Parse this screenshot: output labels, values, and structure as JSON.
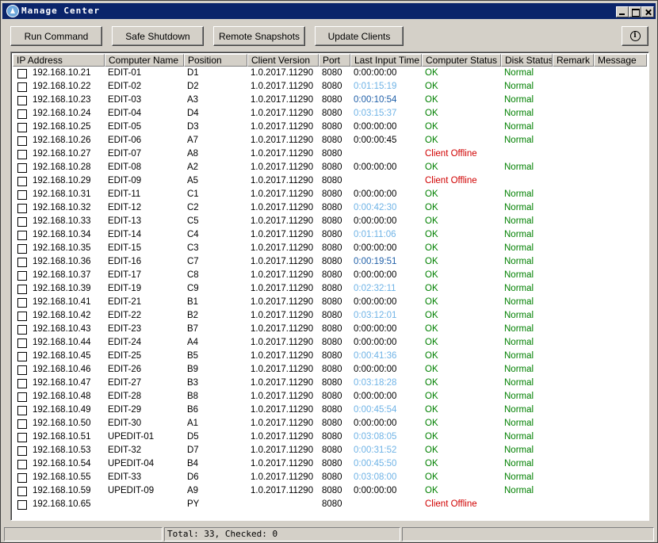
{
  "window": {
    "title": "Manage Center"
  },
  "toolbar": {
    "run_command": "Run Command",
    "safe_shutdown": "Safe Shutdown",
    "remote_snapshots": "Remote Snapshots",
    "update_clients": "Update Clients",
    "info_glyph": "i"
  },
  "table": {
    "columns": [
      "IP Address",
      "Computer Name",
      "Position",
      "Client Version",
      "Port",
      "Last Input Time",
      "Computer Status",
      "Disk Status",
      "Remark",
      "Message"
    ],
    "rows": [
      {
        "ip": "192.168.10.21",
        "name": "EDIT-01",
        "pos": "D1",
        "ver": "1.0.2017.11290",
        "port": "8080",
        "last": "0:00:00:00",
        "last_style": "black",
        "status": "OK",
        "disk": "Normal"
      },
      {
        "ip": "192.168.10.22",
        "name": "EDIT-02",
        "pos": "D2",
        "ver": "1.0.2017.11290",
        "port": "8080",
        "last": "0:01:15:19",
        "last_style": "light",
        "status": "OK",
        "disk": "Normal"
      },
      {
        "ip": "192.168.10.23",
        "name": "EDIT-03",
        "pos": "A3",
        "ver": "1.0.2017.11290",
        "port": "8080",
        "last": "0:00:10:54",
        "last_style": "blue",
        "status": "OK",
        "disk": "Normal"
      },
      {
        "ip": "192.168.10.24",
        "name": "EDIT-04",
        "pos": "D4",
        "ver": "1.0.2017.11290",
        "port": "8080",
        "last": "0:03:15:37",
        "last_style": "light",
        "status": "OK",
        "disk": "Normal"
      },
      {
        "ip": "192.168.10.25",
        "name": "EDIT-05",
        "pos": "D3",
        "ver": "1.0.2017.11290",
        "port": "8080",
        "last": "0:00:00:00",
        "last_style": "black",
        "status": "OK",
        "disk": "Normal"
      },
      {
        "ip": "192.168.10.26",
        "name": "EDIT-06",
        "pos": "A7",
        "ver": "1.0.2017.11290",
        "port": "8080",
        "last": "0:00:00:45",
        "last_style": "black",
        "status": "OK",
        "disk": "Normal"
      },
      {
        "ip": "192.168.10.27",
        "name": "EDIT-07",
        "pos": "A8",
        "ver": "1.0.2017.11290",
        "port": "8080",
        "last": "",
        "last_style": "black",
        "status": "Client Offline",
        "disk": ""
      },
      {
        "ip": "192.168.10.28",
        "name": "EDIT-08",
        "pos": "A2",
        "ver": "1.0.2017.11290",
        "port": "8080",
        "last": "0:00:00:00",
        "last_style": "black",
        "status": "OK",
        "disk": "Normal"
      },
      {
        "ip": "192.168.10.29",
        "name": "EDIT-09",
        "pos": "A5",
        "ver": "1.0.2017.11290",
        "port": "8080",
        "last": "",
        "last_style": "black",
        "status": "Client Offline",
        "disk": ""
      },
      {
        "ip": "192.168.10.31",
        "name": "EDIT-11",
        "pos": "C1",
        "ver": "1.0.2017.11290",
        "port": "8080",
        "last": "0:00:00:00",
        "last_style": "black",
        "status": "OK",
        "disk": "Normal"
      },
      {
        "ip": "192.168.10.32",
        "name": "EDIT-12",
        "pos": "C2",
        "ver": "1.0.2017.11290",
        "port": "8080",
        "last": "0:00:42:30",
        "last_style": "light",
        "status": "OK",
        "disk": "Normal"
      },
      {
        "ip": "192.168.10.33",
        "name": "EDIT-13",
        "pos": "C5",
        "ver": "1.0.2017.11290",
        "port": "8080",
        "last": "0:00:00:00",
        "last_style": "black",
        "status": "OK",
        "disk": "Normal"
      },
      {
        "ip": "192.168.10.34",
        "name": "EDIT-14",
        "pos": "C4",
        "ver": "1.0.2017.11290",
        "port": "8080",
        "last": "0:01:11:06",
        "last_style": "light",
        "status": "OK",
        "disk": "Normal"
      },
      {
        "ip": "192.168.10.35",
        "name": "EDIT-15",
        "pos": "C3",
        "ver": "1.0.2017.11290",
        "port": "8080",
        "last": "0:00:00:00",
        "last_style": "black",
        "status": "OK",
        "disk": "Normal"
      },
      {
        "ip": "192.168.10.36",
        "name": "EDIT-16",
        "pos": "C7",
        "ver": "1.0.2017.11290",
        "port": "8080",
        "last": "0:00:19:51",
        "last_style": "blue",
        "status": "OK",
        "disk": "Normal"
      },
      {
        "ip": "192.168.10.37",
        "name": "EDIT-17",
        "pos": "C8",
        "ver": "1.0.2017.11290",
        "port": "8080",
        "last": "0:00:00:00",
        "last_style": "black",
        "status": "OK",
        "disk": "Normal"
      },
      {
        "ip": "192.168.10.39",
        "name": "EDIT-19",
        "pos": "C9",
        "ver": "1.0.2017.11290",
        "port": "8080",
        "last": "0:02:32:11",
        "last_style": "light",
        "status": "OK",
        "disk": "Normal"
      },
      {
        "ip": "192.168.10.41",
        "name": "EDIT-21",
        "pos": "B1",
        "ver": "1.0.2017.11290",
        "port": "8080",
        "last": "0:00:00:00",
        "last_style": "black",
        "status": "OK",
        "disk": "Normal"
      },
      {
        "ip": "192.168.10.42",
        "name": "EDIT-22",
        "pos": "B2",
        "ver": "1.0.2017.11290",
        "port": "8080",
        "last": "0:03:12:01",
        "last_style": "light",
        "status": "OK",
        "disk": "Normal"
      },
      {
        "ip": "192.168.10.43",
        "name": "EDIT-23",
        "pos": "B7",
        "ver": "1.0.2017.11290",
        "port": "8080",
        "last": "0:00:00:00",
        "last_style": "black",
        "status": "OK",
        "disk": "Normal"
      },
      {
        "ip": "192.168.10.44",
        "name": "EDIT-24",
        "pos": "A4",
        "ver": "1.0.2017.11290",
        "port": "8080",
        "last": "0:00:00:00",
        "last_style": "black",
        "status": "OK",
        "disk": "Normal"
      },
      {
        "ip": "192.168.10.45",
        "name": "EDIT-25",
        "pos": "B5",
        "ver": "1.0.2017.11290",
        "port": "8080",
        "last": "0:00:41:36",
        "last_style": "light",
        "status": "OK",
        "disk": "Normal"
      },
      {
        "ip": "192.168.10.46",
        "name": "EDIT-26",
        "pos": "B9",
        "ver": "1.0.2017.11290",
        "port": "8080",
        "last": "0:00:00:00",
        "last_style": "black",
        "status": "OK",
        "disk": "Normal"
      },
      {
        "ip": "192.168.10.47",
        "name": "EDIT-27",
        "pos": "B3",
        "ver": "1.0.2017.11290",
        "port": "8080",
        "last": "0:03:18:28",
        "last_style": "light",
        "status": "OK",
        "disk": "Normal"
      },
      {
        "ip": "192.168.10.48",
        "name": "EDIT-28",
        "pos": "B8",
        "ver": "1.0.2017.11290",
        "port": "8080",
        "last": "0:00:00:00",
        "last_style": "black",
        "status": "OK",
        "disk": "Normal"
      },
      {
        "ip": "192.168.10.49",
        "name": "EDIT-29",
        "pos": "B6",
        "ver": "1.0.2017.11290",
        "port": "8080",
        "last": "0:00:45:54",
        "last_style": "light",
        "status": "OK",
        "disk": "Normal"
      },
      {
        "ip": "192.168.10.50",
        "name": "EDIT-30",
        "pos": "A1",
        "ver": "1.0.2017.11290",
        "port": "8080",
        "last": "0:00:00:00",
        "last_style": "black",
        "status": "OK",
        "disk": "Normal"
      },
      {
        "ip": "192.168.10.51",
        "name": "UPEDIT-01",
        "pos": "D5",
        "ver": "1.0.2017.11290",
        "port": "8080",
        "last": "0:03:08:05",
        "last_style": "light",
        "status": "OK",
        "disk": "Normal"
      },
      {
        "ip": "192.168.10.53",
        "name": "EDIT-32",
        "pos": "D7",
        "ver": "1.0.2017.11290",
        "port": "8080",
        "last": "0:00:31:52",
        "last_style": "light",
        "status": "OK",
        "disk": "Normal"
      },
      {
        "ip": "192.168.10.54",
        "name": "UPEDIT-04",
        "pos": "B4",
        "ver": "1.0.2017.11290",
        "port": "8080",
        "last": "0:00:45:50",
        "last_style": "light",
        "status": "OK",
        "disk": "Normal"
      },
      {
        "ip": "192.168.10.55",
        "name": "EDIT-33",
        "pos": "D6",
        "ver": "1.0.2017.11290",
        "port": "8080",
        "last": "0:03:08:00",
        "last_style": "light",
        "status": "OK",
        "disk": "Normal"
      },
      {
        "ip": "192.168.10.59",
        "name": "UPEDIT-09",
        "pos": "A9",
        "ver": "1.0.2017.11290",
        "port": "8080",
        "last": "0:00:00:00",
        "last_style": "black",
        "status": "OK",
        "disk": "Normal"
      },
      {
        "ip": "192.168.10.65",
        "name": "",
        "pos": "PY",
        "ver": "",
        "port": "8080",
        "last": "",
        "last_style": "black",
        "status": "Client Offline",
        "disk": ""
      }
    ]
  },
  "status_bar": {
    "summary": "Total: 33, Checked: 0"
  },
  "colors": {
    "ok": "#008000",
    "offline": "#d00000",
    "title_bar": "#0a246a",
    "time_recent": "#1f5fa8",
    "time_idle": "#6fb3e6"
  },
  "icons": {
    "app": "app-logo-icon",
    "info": "info-icon"
  }
}
